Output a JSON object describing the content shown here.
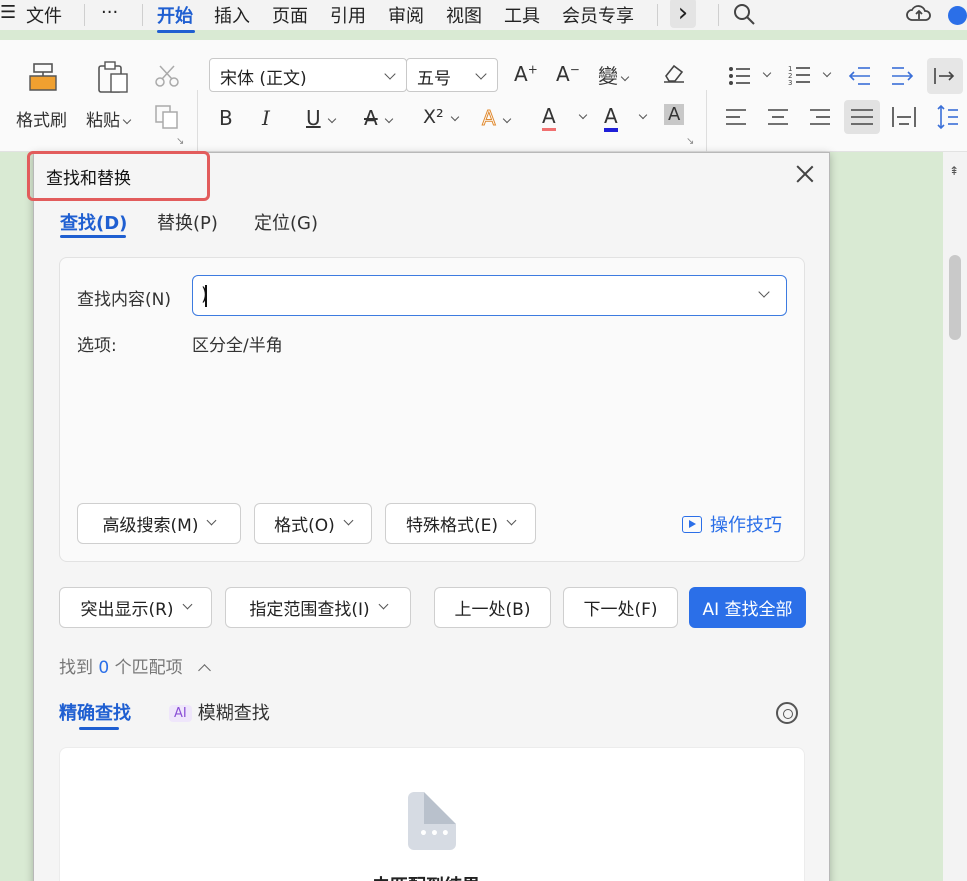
{
  "menubar": {
    "hamburger": "☰",
    "file": "文件",
    "more": "···",
    "tabs": [
      "开始",
      "插入",
      "页面",
      "引用",
      "审阅",
      "视图",
      "工具",
      "会员专享"
    ],
    "active_tab": "开始",
    "next": "›",
    "search_icon": "search-icon",
    "cloud_icon": "cloud-upload-icon"
  },
  "ribbon": {
    "format_painter": "格式刷",
    "paste": "粘贴",
    "font_name": "宋体 (正文)",
    "font_size": "五号",
    "bold": "B",
    "italic": "I",
    "underline": "U",
    "strike": "A",
    "superscript": "X²",
    "text_effect": "A",
    "highlight": "A",
    "font_color": "A",
    "char_shade": "A",
    "font_color_value": "#1f1fd8"
  },
  "dialog": {
    "title": "查找和替换",
    "tabs": [
      "查找(D)",
      "替换(P)",
      "定位(G)"
    ],
    "find_label": "查找内容(N)",
    "find_value": ")",
    "options_label": "选项:",
    "options_value": "区分全/半角",
    "buttons_row1": {
      "advanced": "高级搜索(M)",
      "format": "格式(O)",
      "special": "特殊格式(E)"
    },
    "tips": "操作技巧",
    "buttons_row2": {
      "highlight": "突出显示(R)",
      "range": "指定范围查找(I)",
      "prev": "上一处(B)",
      "next": "下一处(F)",
      "find_all": "AI 查找全部"
    },
    "found_prefix": "找到",
    "found_count": "0",
    "found_suffix": "个匹配项",
    "subtabs": {
      "exact": "精确查找",
      "fuzzy_badge": "AI",
      "fuzzy": "模糊查找"
    },
    "no_result": "未匹配到结果"
  },
  "colors": {
    "accent": "#1f5fd1",
    "primary_button": "#2b6fe8",
    "highlight_box": "#e25c5c",
    "document_bg": "#d9ead3"
  }
}
